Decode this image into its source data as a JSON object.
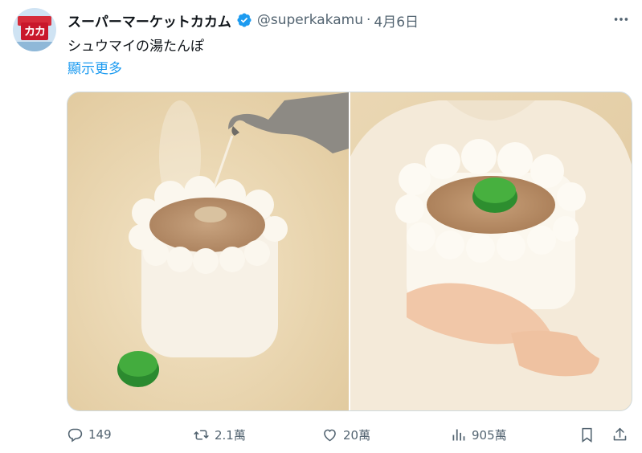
{
  "post": {
    "author_name": "スーパーマーケットカカム",
    "handle": "@superkakamu",
    "separator": "·",
    "date": "4月6日",
    "text": "シュウマイの湯たんぽ",
    "show_more": "顯示更多",
    "avatar_text": "カカ"
  },
  "metrics": {
    "replies": "149",
    "reposts": "2.1萬",
    "likes": "20萬",
    "views": "905萬"
  },
  "colors": {
    "link": "#1d9bf0",
    "muted": "#536471",
    "verified": "#1d9bf0"
  },
  "icons": {
    "verified": "verified-badge-icon",
    "more": "more-options-icon",
    "reply": "reply-icon",
    "repost": "repost-icon",
    "like": "heart-icon",
    "views": "views-chart-icon",
    "bookmark": "bookmark-icon",
    "share": "share-icon"
  }
}
